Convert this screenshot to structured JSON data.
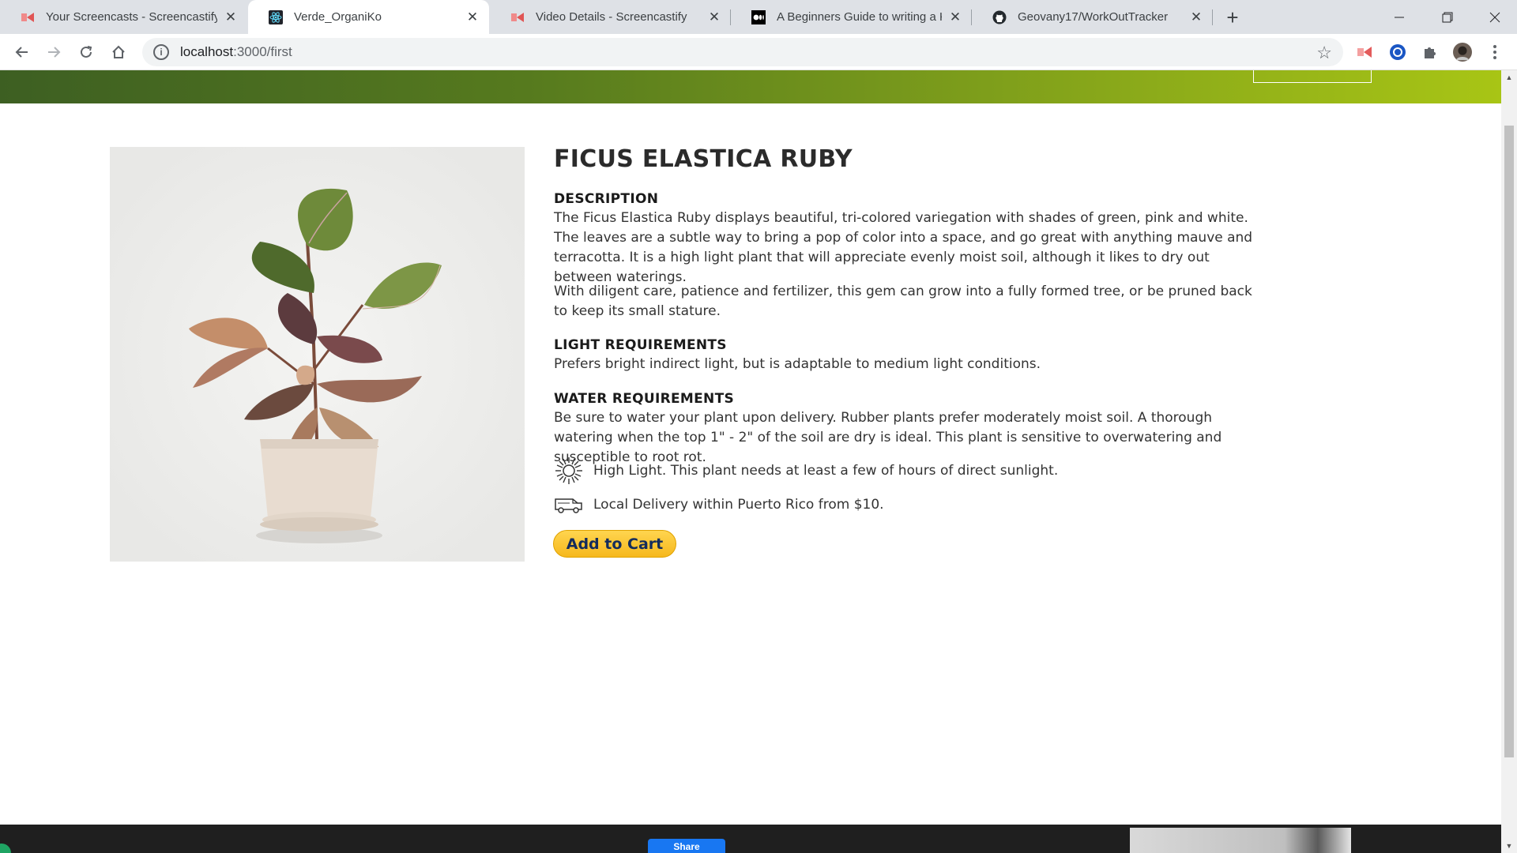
{
  "browser": {
    "tabs": [
      {
        "title": "Your Screencasts - Screencastify",
        "icon": "screencastify-icon"
      },
      {
        "title": "Verde_OrganiKo",
        "icon": "react-icon"
      },
      {
        "title": "Video Details - Screencastify",
        "icon": "screencastify-icon"
      },
      {
        "title": "A Beginners Guide to writing a K",
        "icon": "medium-icon"
      },
      {
        "title": "Geovany17/WorkOutTracker",
        "icon": "github-icon"
      }
    ],
    "url_host": "localhost",
    "url_path": ":3000/first"
  },
  "product": {
    "title": "FICUS ELASTICA RUBY",
    "description_heading": "DESCRIPTION",
    "description_p1": "The Ficus Elastica Ruby displays beautiful, tri-colored variegation with shades of green, pink and white. The leaves are a subtle way to bring a pop of color into a space, and go great with anything mauve and terracotta. It is a high light plant that will appreciate evenly moist soil, although it likes to dry out between waterings.",
    "description_p2": "With diligent care, patience and fertilizer, this gem can grow into a fully formed tree, or be pruned back to keep its small stature.",
    "light_heading": "LIGHT REQUIREMENTS",
    "light_text": "Prefers bright indirect light, but is adaptable to medium light conditions.",
    "water_heading": "WATER REQUIREMENTS",
    "water_text": "Be sure to water your plant upon delivery. Rubber plants prefer moderately moist soil. A thorough watering when the top 1\" - 2\" of the soil are dry is ideal. This plant is sensitive to overwatering and susceptible to root rot.",
    "feature_light": "High Light. This plant needs at least a few of hours of direct sunlight.",
    "feature_delivery": "Local Delivery within Puerto Rico from $10.",
    "cart_label": "Add to Cart"
  },
  "footer": {
    "share_label": "Share"
  },
  "colors": {
    "hero_start": "#3d5f22",
    "hero_end": "#a8c515",
    "cart_button": "#f6b81d",
    "footer": "#1f1f1f"
  }
}
